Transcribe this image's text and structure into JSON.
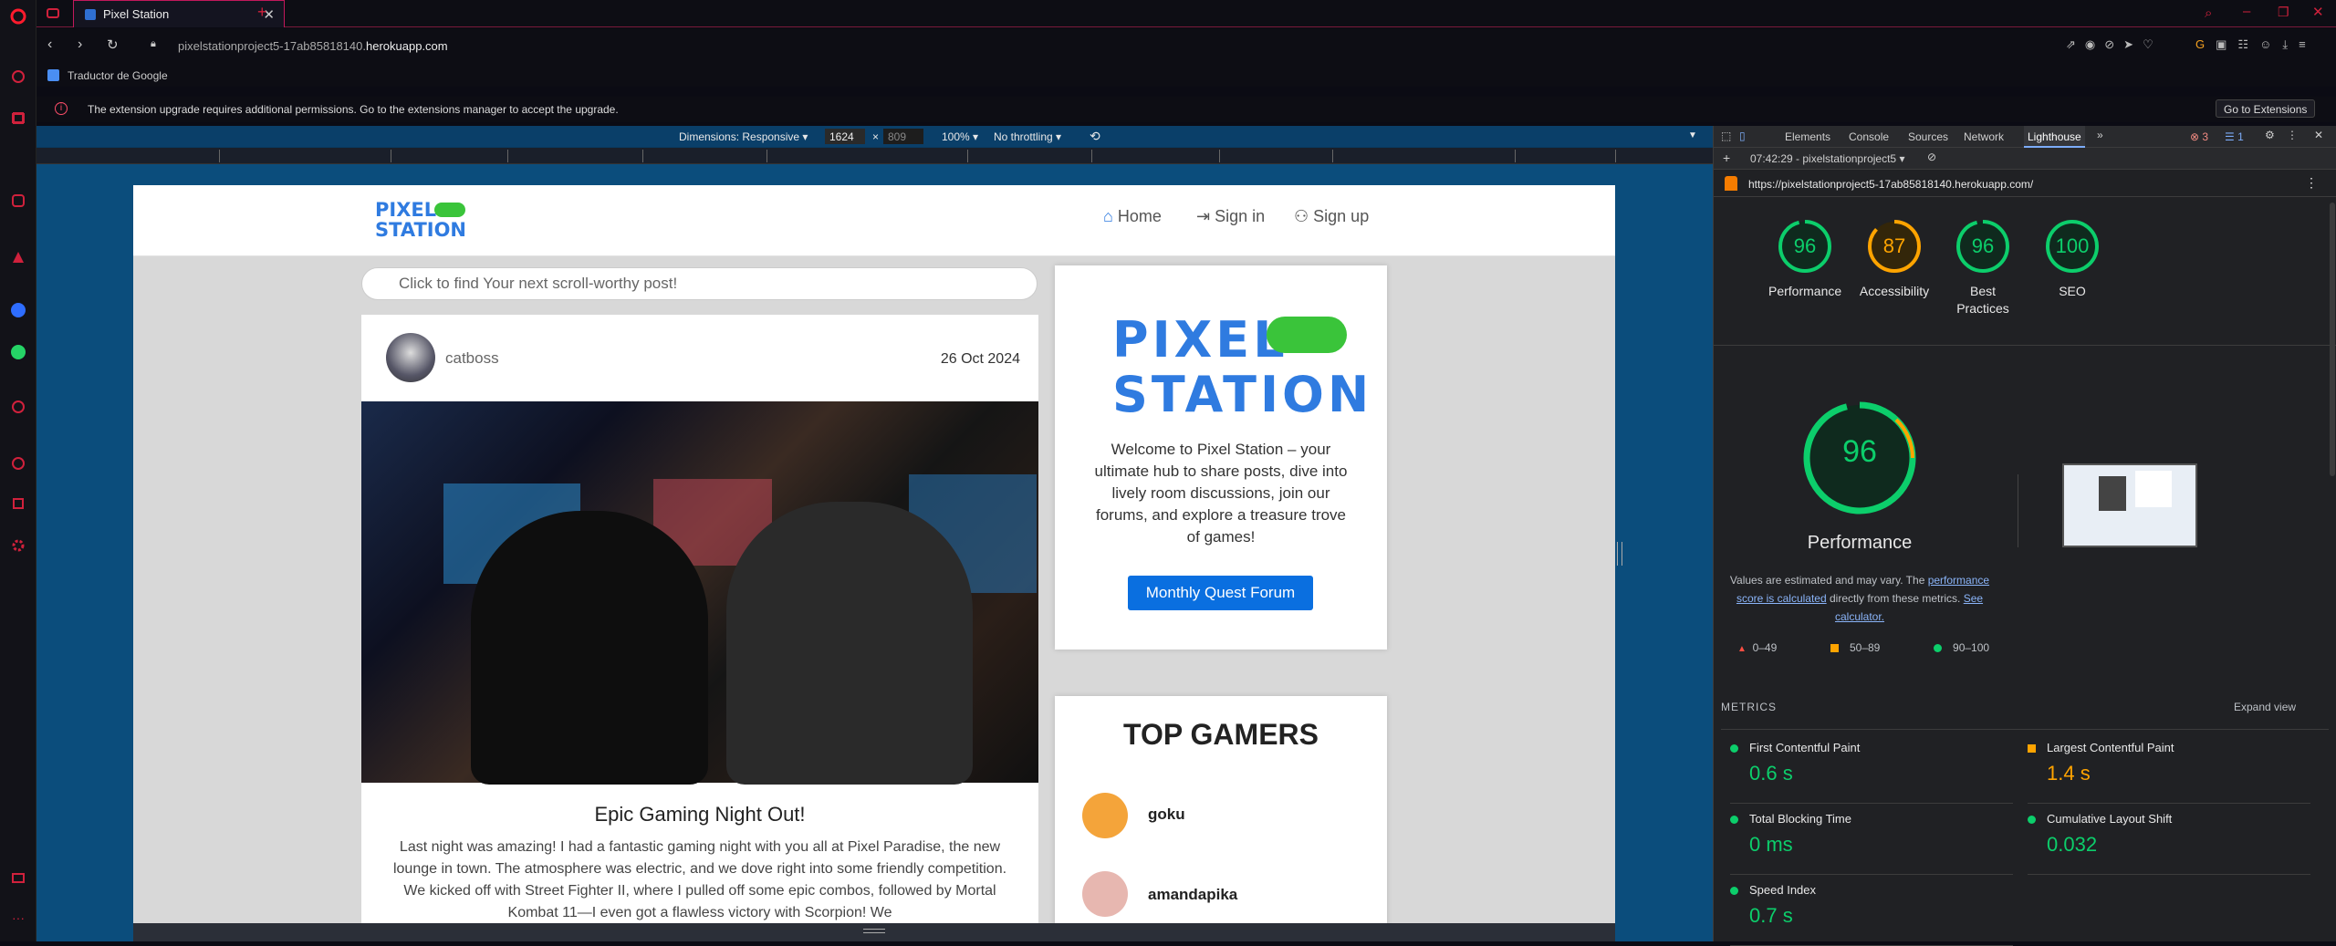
{
  "browser": {
    "tab_title": "Pixel Station",
    "url_prefix": "pixelstationproject5-17ab85818140.",
    "url_domain": "herokuapp.com",
    "bookmark": "Traductor de Google",
    "info_message": "The extension upgrade requires additional permissions. Go to the extensions manager to accept the upgrade.",
    "info_button": "Go to Extensions"
  },
  "responsive_toolbar": {
    "dimensions_label": "Dimensions: Responsive",
    "width": "1624",
    "height": "809",
    "zoom": "100%",
    "throttling": "No throttling"
  },
  "site": {
    "logo_line1": "PIXEL",
    "logo_line2": "STATION",
    "nav": {
      "home": "Home",
      "signin": "Sign in",
      "signup": "Sign up"
    },
    "search_placeholder": "Click to find Your next scroll-worthy post!",
    "post": {
      "author": "catboss",
      "date": "26 Oct 2024",
      "title": "Epic Gaming Night Out!",
      "body": "Last night was amazing! I had a fantastic gaming night with you all at Pixel Paradise, the new lounge in town. The atmosphere was electric, and we dove right into some friendly competition. We kicked off with Street Fighter II, where I pulled off some epic combos, followed by Mortal Kombat 11—I even got a flawless victory with Scorpion! We"
    },
    "welcome": {
      "logo_line1": "PIXEL",
      "logo_line2": "STATION",
      "text": "Welcome to Pixel Station – your ultimate hub to share posts, dive into lively room discussions, join our forums, and explore a treasure trove of games!",
      "button": "Monthly Quest Forum"
    },
    "top_gamers": {
      "title": "TOP GAMERS",
      "gamers": [
        "goku",
        "amandapika"
      ]
    }
  },
  "devtools": {
    "tabs": [
      "Elements",
      "Console",
      "Sources",
      "Network",
      "Lighthouse"
    ],
    "active_tab": "Lighthouse",
    "errors": "3",
    "messages": "1",
    "report_select": "07:42:29 - pixelstationproject5",
    "report_url": "https://pixelstationproject5-17ab85818140.herokuapp.com/",
    "scores": [
      {
        "label": "Performance",
        "value": 96,
        "color": "#0cce6b"
      },
      {
        "label": "Accessibility",
        "value": 87,
        "color": "#ffa400"
      },
      {
        "label": "Best Practices",
        "value": 96,
        "color": "#0cce6b"
      },
      {
        "label": "SEO",
        "value": 100,
        "color": "#0cce6b"
      }
    ],
    "big_score": {
      "value": 96,
      "label": "Performance"
    },
    "note_part1": "Values are estimated and may vary. The ",
    "note_link1": "performance score is calculated",
    "note_part2": " directly from these metrics. ",
    "note_link2": "See calculator.",
    "legend": {
      "fail": "0–49",
      "average": "50–89",
      "pass": "90–100"
    },
    "metrics_header": "METRICS",
    "expand_view": "Expand view",
    "metrics": [
      {
        "name": "First Contentful Paint",
        "value": "0.6 s",
        "status": "pass"
      },
      {
        "name": "Largest Contentful Paint",
        "value": "1.4 s",
        "status": "average"
      },
      {
        "name": "Total Blocking Time",
        "value": "0 ms",
        "status": "pass"
      },
      {
        "name": "Cumulative Layout Shift",
        "value": "0.032",
        "status": "pass"
      },
      {
        "name": "Speed Index",
        "value": "0.7 s",
        "status": "pass"
      }
    ],
    "colors": {
      "pass": "#0cce6b",
      "average": "#ffa400",
      "fail": "#ff4e42"
    }
  }
}
